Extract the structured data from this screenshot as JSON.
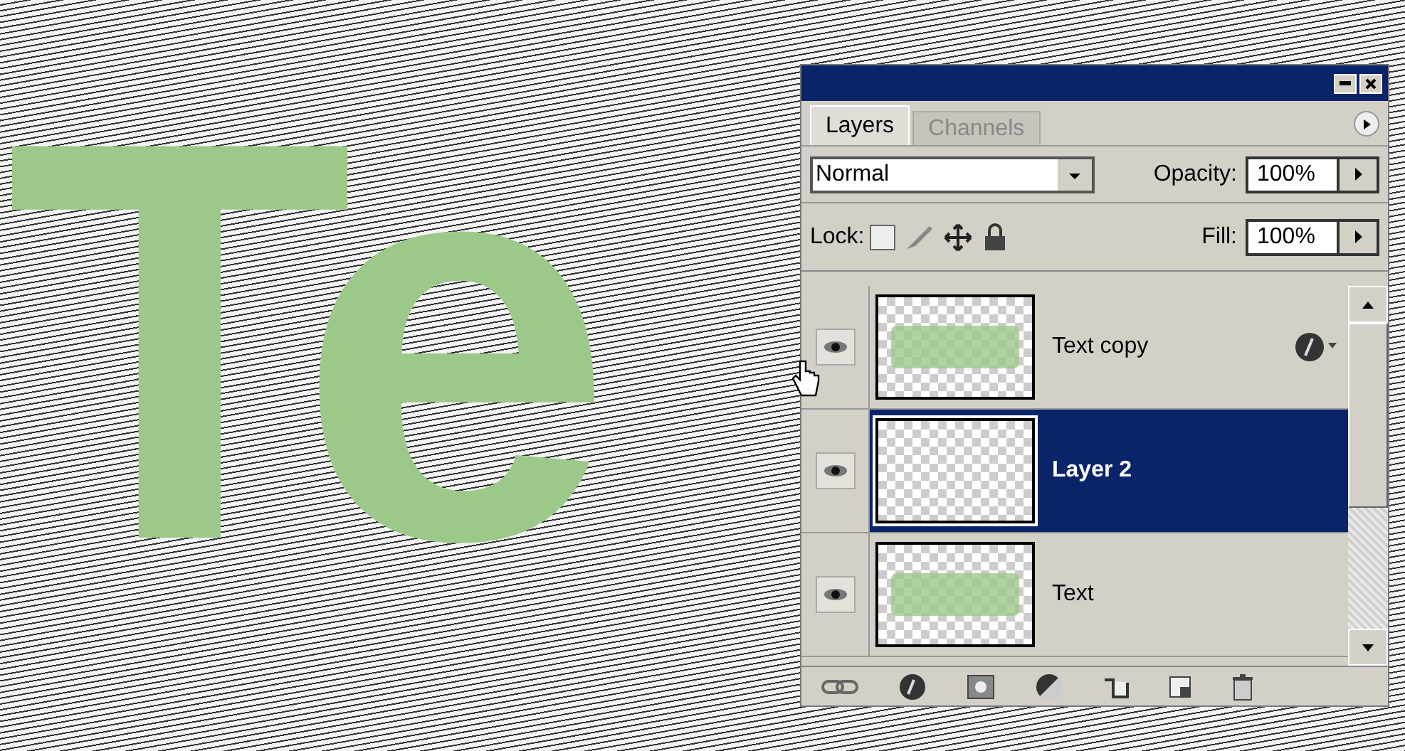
{
  "canvas": {
    "text": "Te"
  },
  "panel": {
    "tabs": [
      {
        "label": "Layers",
        "selected": true
      },
      {
        "label": "Channels",
        "selected": false
      }
    ],
    "blend_mode": "Normal",
    "opacity_label": "Opacity:",
    "opacity": "100%",
    "lock_label": "Lock:",
    "fill_label": "Fill:",
    "fill": "100%",
    "layers": [
      {
        "name": "Text copy",
        "visible": true,
        "selected": false,
        "kind": "text",
        "effects": true
      },
      {
        "name": "Layer 2",
        "visible": true,
        "selected": true,
        "kind": "empty",
        "effects": false
      },
      {
        "name": "Text",
        "visible": true,
        "selected": false,
        "kind": "text",
        "effects": false
      }
    ]
  }
}
